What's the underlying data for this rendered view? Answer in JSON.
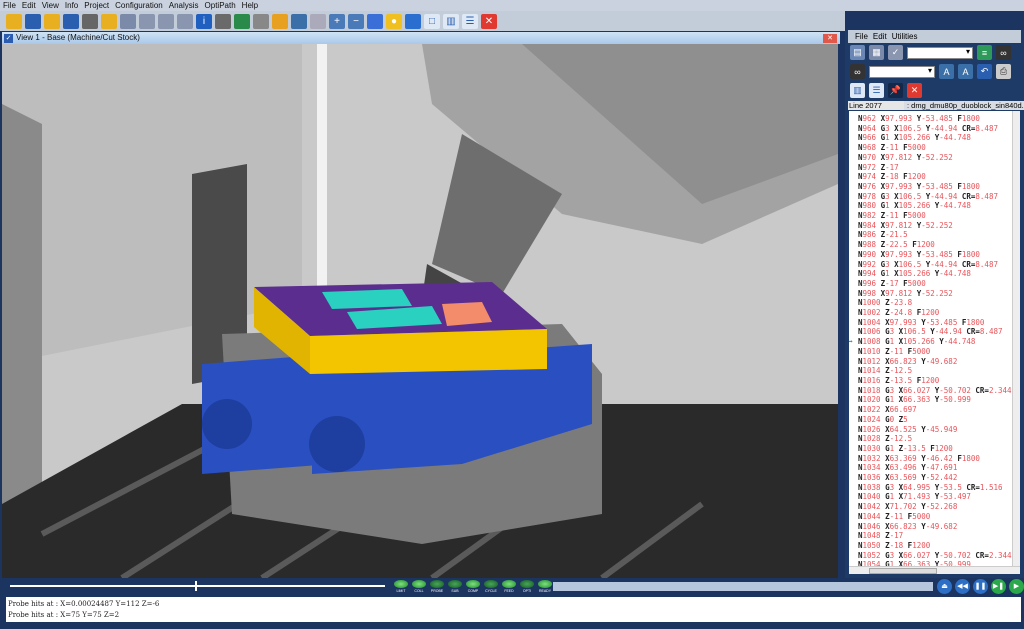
{
  "menu": [
    "File",
    "Edit",
    "View",
    "Info",
    "Project",
    "Configuration",
    "Analysis",
    "OptiPath",
    "Help"
  ],
  "toolbar_icons": [
    "open-folder-icon",
    "save-icon",
    "open-folder-icon",
    "save-icon",
    "tool-icon",
    "open-check-icon",
    "tree-icon",
    "stock-icon",
    "stock-check-icon",
    "compare-icon",
    "info-icon",
    "machine-icon",
    "fixture-icon",
    "tool-assembly-icon",
    "eraser-icon",
    "measure-icon",
    "zoom-box-icon",
    "zoom-in-icon",
    "zoom-out-icon",
    "fit-icon",
    "sphere-icon",
    "reverse-icon",
    "single-view-icon",
    "split-vertical-icon",
    "split-horizontal-icon",
    "close-icon"
  ],
  "view": {
    "title": "View 1 - Base (Machine/Cut Stock)"
  },
  "right_panel": {
    "menu": [
      "File",
      "Edit",
      "Utilities"
    ],
    "line_label": "Line 2077",
    "file_name": ": dmg_dmu80p_duoblock_sin840d.mpf",
    "current_line": "N1008",
    "code": [
      "N962 X97.993 Y-53.485 F1800",
      "N964 G3 X106.5 Y-44.94 CR=8.487",
      "N966 G1 X105.266 Y-44.748",
      "N968 Z-11 F5000",
      "N970 X97.812 Y-52.252",
      "N972 Z-17",
      "N974 Z-18 F1200",
      "N976 X97.993 Y-53.485 F1800",
      "N978 G3 X106.5 Y-44.94 CR=8.487",
      "N980 G1 X105.266 Y-44.748",
      "N982 Z-11 F5000",
      "N984 X97.812 Y-52.252",
      "N986 Z-21.5",
      "N988 Z-22.5 F1200",
      "N990 X97.993 Y-53.485 F1800",
      "N992 G3 X106.5 Y-44.94 CR=8.487",
      "N994 G1 X105.266 Y-44.748",
      "N996 Z-17 F5000",
      "N998 X97.812 Y-52.252",
      "N1000 Z-23.8",
      "N1002 Z-24.8 F1200",
      "N1004 X97.993 Y-53.485 F1800",
      "N1006 G3 X106.5 Y-44.94 CR=8.487",
      "N1008 G1 X105.266 Y-44.748",
      "N1010 Z-11 F5000",
      "N1012 X66.823 Y-49.682",
      "N1014 Z-12.5",
      "N1016 Z-13.5 F1200",
      "N1018 G3 X66.027 Y-50.702 CR=2.344 F",
      "N1020 G1 X66.363 Y-50.999",
      "N1022 X66.697",
      "N1024 G0 Z5",
      "N1026 X64.525 Y-45.949",
      "N1028 Z-12.5",
      "N1030 G1 Z-13.5 F1200",
      "N1032 X63.369 Y-46.42 F1800",
      "N1034 X63.496 Y-47.691",
      "N1036 X63.569 Y-52.442",
      "N1038 G3 X64.995 Y-53.5 CR=1.516",
      "N1040 G1 X71.493 Y-53.497",
      "N1042 X71.702 Y-52.268",
      "N1044 Z-11 F5000",
      "N1046 X66.823 Y-49.682",
      "N1048 Z-17",
      "N1050 Z-18 F1200",
      "N1052 G3 X66.027 Y-50.702 CR=2.344 F",
      "N1054 G1 X66.363 Y-50.999"
    ]
  },
  "status_leds": [
    "LIMIT",
    "COLL",
    "PROBE",
    "SUB",
    "COMP",
    "CYCLE",
    "FEED",
    "OPTI",
    "READY"
  ],
  "playback": [
    "eject-icon",
    "rewind-icon",
    "pause-icon",
    "step-icon",
    "play-icon"
  ],
  "output": [
    "Probe hits at : X=0.00024487 Y=112 Z=-6",
    "Probe hits at : X=75 Y=75 Z=2"
  ],
  "colors": {
    "panel": "#1e3a66",
    "code_value": "#e8545a",
    "stock_top": "#5b2d8e",
    "stock_side": "#f2c500",
    "vise": "#2a4fc0"
  }
}
